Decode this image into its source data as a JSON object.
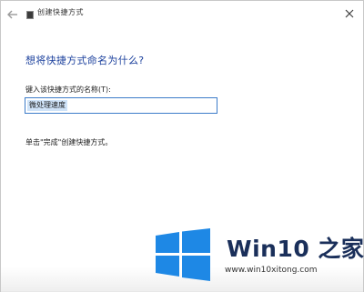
{
  "window": {
    "title": "创建快捷方式",
    "back_icon": "back-arrow-icon",
    "close_icon": "close-icon"
  },
  "main": {
    "heading": "想将快捷方式命名为什么?",
    "field_label": "键入该快捷方式的名称(T):",
    "name_value": "微处理速度",
    "hint": "单击\"完成\"创建快捷方式。"
  },
  "watermark": {
    "brand_title": "Win10 之家",
    "brand_url": "www.win10xitong.com",
    "logo_color": "#1e88e5"
  }
}
